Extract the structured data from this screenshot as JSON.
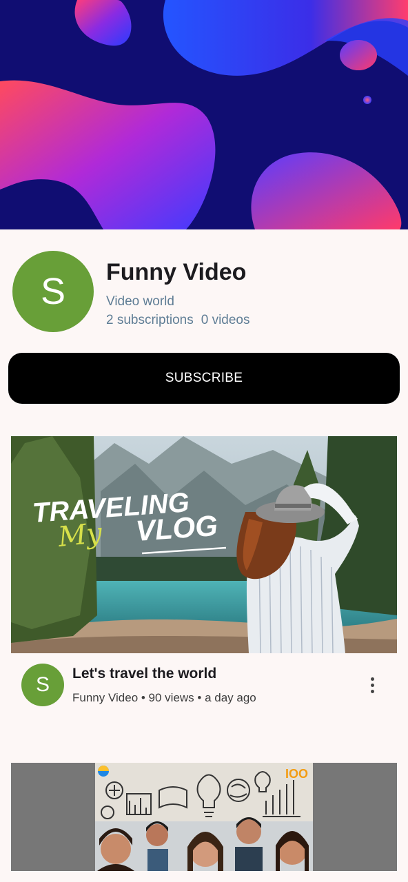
{
  "channel": {
    "avatar_letter": "S",
    "name": "Funny Video",
    "handle": "Video world",
    "subscriptions": "2 subscriptions",
    "videos": "0 videos",
    "avatar_color": "#689f38"
  },
  "subscribe": {
    "label": "SUBSCRIBE"
  },
  "videos": [
    {
      "avatar_letter": "S",
      "title": "Let's travel the world",
      "meta": "Funny Video • 90 views • a day ago",
      "thumbnail_text": [
        "TRAVELING",
        "My",
        "VLOG"
      ]
    },
    {
      "thumbnail_text": [
        "IOO"
      ]
    }
  ],
  "icons": {
    "more": "more-vertical-icon"
  }
}
